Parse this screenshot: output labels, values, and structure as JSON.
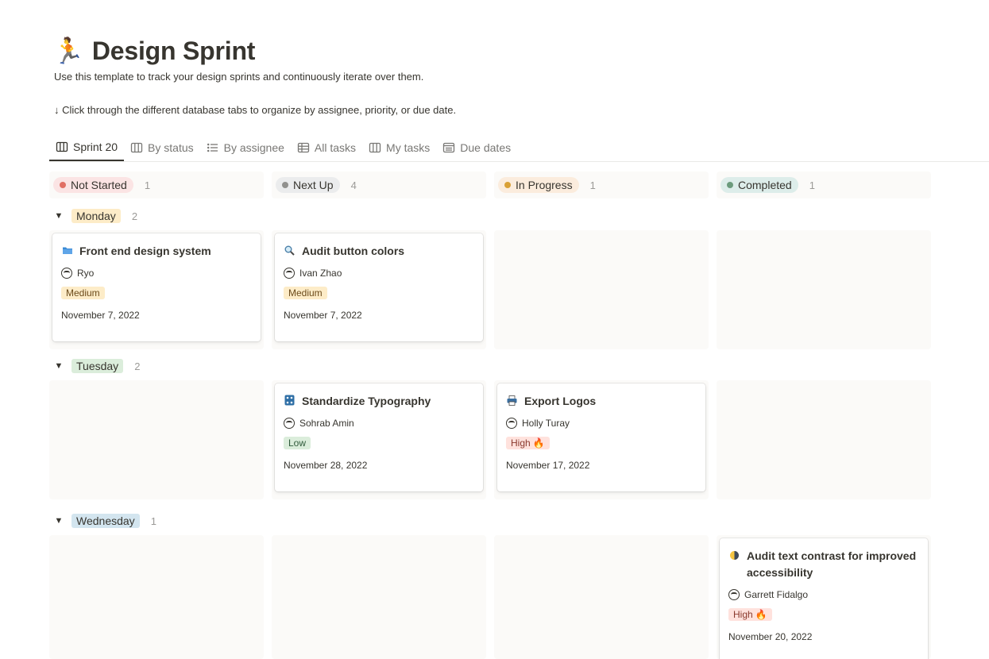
{
  "page": {
    "emoji": "🏃",
    "title": "Design Sprint",
    "description_1": "Use this template to track your design sprints and continuously iterate over them.",
    "description_2": "↓ Click through the different database tabs to organize by assignee, priority, or due date."
  },
  "tabs": [
    {
      "label": "Sprint 20",
      "icon": "board-icon"
    },
    {
      "label": "By status",
      "icon": "board-icon"
    },
    {
      "label": "By assignee",
      "icon": "list-icon"
    },
    {
      "label": "All tasks",
      "icon": "table-icon"
    },
    {
      "label": "My tasks",
      "icon": "board-icon"
    },
    {
      "label": "Due dates",
      "icon": "calendar-icon"
    }
  ],
  "columns": [
    {
      "label": "Not Started",
      "count": "1",
      "pill_color": "#fbe4e4",
      "dot_color": "#e16f64"
    },
    {
      "label": "Next Up",
      "count": "4",
      "pill_color": "#ebeced",
      "dot_color": "#91918e"
    },
    {
      "label": "In Progress",
      "count": "1",
      "pill_color": "#fbecdd",
      "dot_color": "#d9a036"
    },
    {
      "label": "Completed",
      "count": "1",
      "pill_color": "#ddedea",
      "dot_color": "#6c9b7d"
    }
  ],
  "groups": [
    {
      "label": "Monday",
      "count": "2",
      "color": "#fdecc8"
    },
    {
      "label": "Tuesday",
      "count": "2",
      "color": "#dbeddb"
    },
    {
      "label": "Wednesday",
      "count": "1",
      "color": "#d3e5ef"
    }
  ],
  "cards": [
    {
      "title": "Front end design system",
      "icon": "folder-icon",
      "person": "Ryo",
      "priority": "Medium",
      "priority_emoji": "",
      "priority_color": "#fdecc8",
      "date": "November 7, 2022"
    },
    {
      "title": "Audit button colors",
      "icon": "magnifier-icon",
      "person": "Ivan Zhao",
      "priority": "Medium",
      "priority_emoji": "",
      "priority_color": "#fdecc8",
      "date": "November 7, 2022"
    },
    {
      "title": "Standardize Typography",
      "icon": "abacus-icon",
      "person": "Sohrab Amin",
      "priority": "Low",
      "priority_emoji": "",
      "priority_color": "#dbeddb",
      "date": "November 28, 2022"
    },
    {
      "title": "Export Logos",
      "icon": "printer-icon",
      "person": "Holly Turay",
      "priority": "High",
      "priority_emoji": "🔥",
      "priority_color": "#ffe2dd",
      "date": "November 17, 2022"
    },
    {
      "title": "Audit text contrast for improved accessibility",
      "icon": "half-circle-icon",
      "person": "Garrett Fidalgo",
      "priority": "High",
      "priority_emoji": "🔥",
      "priority_color": "#ffe2dd",
      "date": "November 20, 2022"
    }
  ]
}
